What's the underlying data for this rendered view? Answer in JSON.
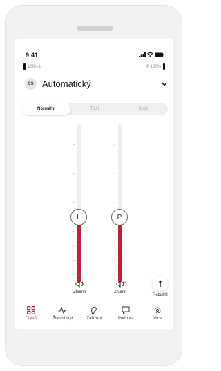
{
  "status_bar": {
    "time": "9:41"
  },
  "battery": {
    "left_label": "100% L",
    "right_label": "P 100%"
  },
  "program": {
    "icon_text": "CS",
    "name": "Automatický"
  },
  "modes": {
    "items": [
      "Normální",
      "Tišší",
      "Čistší"
    ],
    "selected": "Normální"
  },
  "sliders": {
    "left": {
      "knob_label": "L",
      "bottom_label": "L",
      "level": 0.5
    },
    "right": {
      "knob_label": "P",
      "bottom_label": "P",
      "level": 0.5
    }
  },
  "controls": {
    "mute_left_label": "Ztlumit",
    "mute_right_label": "Ztlumit",
    "split_label": "Rozdělit"
  },
  "nav": {
    "items": [
      "Domů",
      "Životní styl",
      "Zařízení",
      "Podpora",
      "Více"
    ],
    "active": "Domů"
  },
  "colors": {
    "accent": "#c0223a",
    "track": "#eeeeee"
  }
}
